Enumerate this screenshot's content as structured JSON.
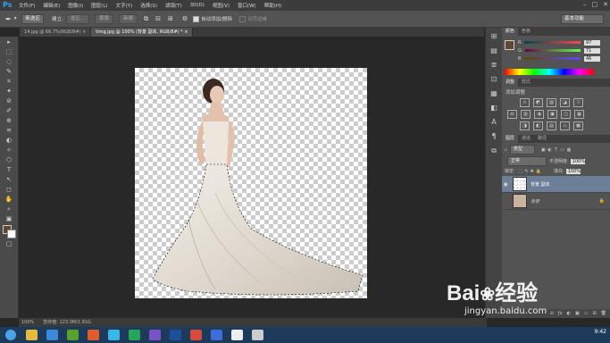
{
  "app": {
    "logo": "Ps"
  },
  "menu": [
    "文件(F)",
    "编辑(E)",
    "图像(I)",
    "图层(L)",
    "文字(Y)",
    "选择(S)",
    "滤镜(T)",
    "3D(D)",
    "视图(V)",
    "窗口(W)",
    "帮助(H)"
  ],
  "window_controls": [
    "–",
    "□",
    "✕"
  ],
  "options": {
    "mode": "新选区",
    "adjust_label": "建立:",
    "btn_selection": "选区...",
    "btn_mask": "蒙版",
    "btn_new": "新建",
    "auto_add_label": "自动添加/删除",
    "align_edges_label": "对齐边缘",
    "workspace": "基本功能"
  },
  "tabs": [
    {
      "label": "14.jpg @ 66.7%(RGB/8#)",
      "close": "×"
    },
    {
      "label": "timg.jpg @ 100% (背景 副本, RGB/8#) *",
      "close": "×"
    }
  ],
  "tools": [
    "▸",
    "⬚",
    "◌",
    "✎",
    "⌗",
    "✦",
    "⊘",
    "✐",
    "⊕",
    "≋",
    "◐",
    "✧",
    "⬡",
    "T",
    "↖",
    "◻",
    "✋",
    "⌕",
    "▣",
    "◆",
    "▢"
  ],
  "status": {
    "zoom": "100%",
    "doc_label": "暂存盘: 123.0M/1.91G"
  },
  "right_icons": [
    "⊞",
    "▤",
    "≣",
    "⊡",
    "▦",
    "◧",
    "A",
    "¶",
    "⧉"
  ],
  "color_panel": {
    "tabs": [
      "颜色",
      "色板"
    ],
    "sliders": [
      {
        "label": "R",
        "value": "97",
        "colors": [
          "#00454c",
          "#ff454c"
        ]
      },
      {
        "label": "G",
        "value": "71",
        "colors": [
          "#61004c",
          "#61ff4c"
        ]
      },
      {
        "label": "B",
        "value": "46",
        "colors": [
          "#614700",
          "#6147ff"
        ]
      }
    ]
  },
  "adjust_panel": {
    "tabs": [
      "调整",
      "样式"
    ],
    "title": "添加调整",
    "row1": [
      "☼",
      "◩",
      "▨",
      "◪",
      "▽"
    ],
    "row2": [
      "⚖",
      "▥",
      "◑",
      "▣",
      "◫",
      "▦"
    ],
    "row3": [
      "◨",
      "◧",
      "▤",
      "◇",
      "▩"
    ]
  },
  "layers_panel": {
    "tabs": [
      "图层",
      "通道",
      "路径"
    ],
    "filter_label": "类型",
    "blend_mode": "正常",
    "opacity_label": "不透明度:",
    "opacity": "100%",
    "lock_label": "锁定:",
    "fill_label": "填充:",
    "fill": "100%",
    "layers": [
      {
        "name": "背景 副本",
        "selected": true,
        "visible": true
      },
      {
        "name": "背景",
        "selected": false,
        "visible": false,
        "locked": true
      }
    ],
    "footer_icons": [
      "⊝",
      "ƒx",
      "◐",
      "▣",
      "▭",
      "⊞",
      "🗑"
    ]
  },
  "taskbar": {
    "icons": [
      "#e7b83c",
      "#3c8ad8",
      "#5aa02c",
      "#e05c2a",
      "#3bb6e8",
      "#26a65b",
      "#7a52c8",
      "#1c4f9c",
      "#d84a3c",
      "#3c6dd8",
      "#eeeeee",
      "#cccccc"
    ],
    "time": "9:42"
  },
  "watermark": {
    "brand": "Bai",
    "brand2": "经验",
    "url": "jingyan.baidu.com"
  }
}
